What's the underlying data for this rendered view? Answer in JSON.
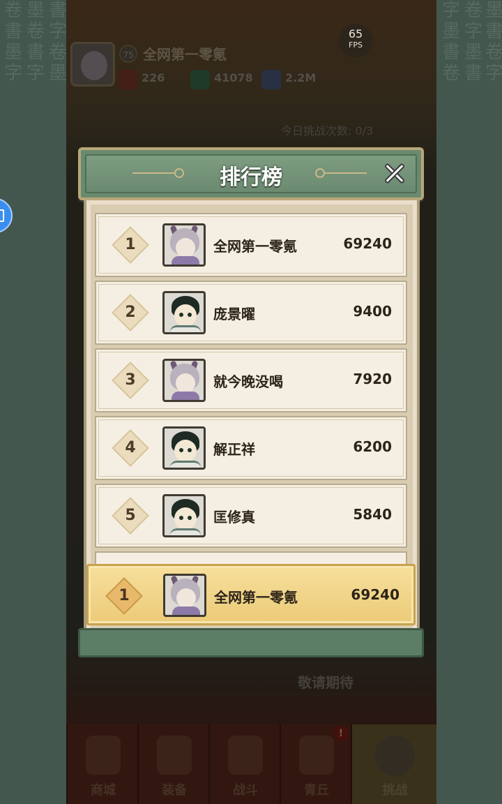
{
  "fps": {
    "value": "65",
    "unit": "FPS"
  },
  "hud": {
    "level": "75",
    "player_name": "全网第一零氪",
    "resources": [
      "226",
      "41078",
      "2.2M"
    ]
  },
  "challenge_count": "今日挑战次数: 0/3",
  "lower_text": "敬请期待",
  "leaderboard": {
    "title": "排行榜",
    "rows": [
      {
        "rank": "1",
        "name": "全网第一零氪",
        "score": "69240",
        "avatar": "horned-avatar"
      },
      {
        "rank": "2",
        "name": "庞景曜",
        "score": "9400",
        "avatar": "boy-avatar"
      },
      {
        "rank": "3",
        "name": "就今晚没喝",
        "score": "7920",
        "avatar": "horned-avatar"
      },
      {
        "rank": "4",
        "name": "解正祥",
        "score": "6200",
        "avatar": "boy-avatar"
      },
      {
        "rank": "5",
        "name": "匡修真",
        "score": "5840",
        "avatar": "boy-avatar"
      }
    ],
    "self": {
      "rank": "1",
      "name": "全网第一零氪",
      "score": "69240"
    }
  },
  "bottom_nav": {
    "items": [
      {
        "label": "商城"
      },
      {
        "label": "装备"
      },
      {
        "label": "战斗"
      },
      {
        "label": "青丘"
      },
      {
        "label": "挑战"
      }
    ],
    "active": "挑战",
    "badge": "!"
  },
  "colors": {
    "header_green": "#6a8a70",
    "parchment": "#f5efe3",
    "self_highlight": "#f6df9c"
  }
}
